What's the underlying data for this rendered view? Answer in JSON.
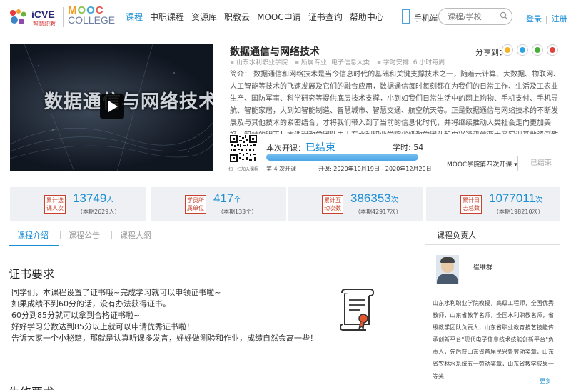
{
  "header": {
    "logo_text": "iCVE",
    "logo_sub": "智慧职教",
    "mooc_top": "MOOC",
    "mooc_bottom": "COLLEGE",
    "nav": [
      "课程",
      "中职课程",
      "资源库",
      "职教云",
      "MOOC申请",
      "证书查询",
      "帮助中心"
    ],
    "mobile_label": "手机端",
    "search_placeholder": "课程/学校",
    "login": "登录",
    "sep": "|",
    "register": "注册"
  },
  "course": {
    "video_title": "数据通信与网络技术",
    "title": "数据通信与网络技术",
    "share_label": "分享到：",
    "meta": [
      "山东水利职业学院",
      "所属专业: 电子信息大类",
      "学时安排: 6 小时每周"
    ],
    "intro": "简介： 数据通信和网络技术是当今信息时代的基础和关键支撑技术之一，随着云计算、大数据、物联网、人工智能等技术的飞速发展及它们的融合应用，数据通信每时每刻都在为我们的日常工作、生活及工农业生产、国防军事、科学研究等提供底层技术支撑，小到如我们日常生活中的网上购物、手机支付、手机导航、智能家居，大到如智能制造、智慧城市、智慧交通、航空航天等。正是数据通信与网络技术的不断发展及与其他技术的紧密结合，才将我们带入到了当前的信息化时代，并将继续推动人类社会走向更加美好、智慧的明天！本课程教学团队由山东水利职业学院省级教学团队和中兴通讯信亚太区实训基地资深教师和专业技术人员共同组建，其中……",
    "intro_more": "更多",
    "qr_label": "扫一扫加入课程",
    "session_label": "本次开课：",
    "session_status": "已结束",
    "hours_label": "学时: 54",
    "progress": 1.0,
    "times": "第 4 次开课",
    "dates": "开课: 2020年10月19日 - 2020年12月20日",
    "term_select": "MOOC学院第四次开课",
    "ended_btn": "已结束"
  },
  "stats": [
    {
      "badge": "累计选课人次",
      "value": "13749",
      "unit": "人",
      "sub": "（本期2629人）"
    },
    {
      "badge": "学员所属单位",
      "value": "417",
      "unit": "个",
      "sub": "（本期133个）"
    },
    {
      "badge": "累计互动次数",
      "value": "386353",
      "unit": "次",
      "sub": "（本期42917次）"
    },
    {
      "badge": "累计日志总数",
      "value": "1077011",
      "unit": "次",
      "sub": "（本期198210次）"
    }
  ],
  "tabs": [
    "课程介绍",
    "课程公告",
    "课程大纲"
  ],
  "section": {
    "title": "证书要求",
    "lines": [
      "同学们，本课程设置了证书哦~完成学习就可以申领证书啦~",
      "如果成绩不到60分的话，没有办法获得证书。",
      "60分到85分就可以拿到合格证书啦~",
      "好好学习分数达到85分以上就可以申请优秀证书啦！",
      "告诉大家一个小秘籍，那就是认真听课多发言，好好做测验和作业，成绩自然会高一些！"
    ],
    "next_title": "先修要求"
  },
  "sidebar": {
    "head": "课程负责人",
    "teacher_name": "崔维群",
    "bio": "山东水利职业学院教授，高级工程师，全国优秀教师，山东省教学名师，全国水利职教名师，省级教学团队负责人，山东省职业教育技艺技能传承创新平台\"现代电子信息技术技能创新平台\"负责人，先后获山东省首届民兴鲁劳动奖章，山东省农林水系统五一劳动奖章，山东省教学成果一等奖",
    "more": "更多"
  },
  "colors": {
    "accent": "#1a8ed6",
    "badge": "#c7412c"
  }
}
